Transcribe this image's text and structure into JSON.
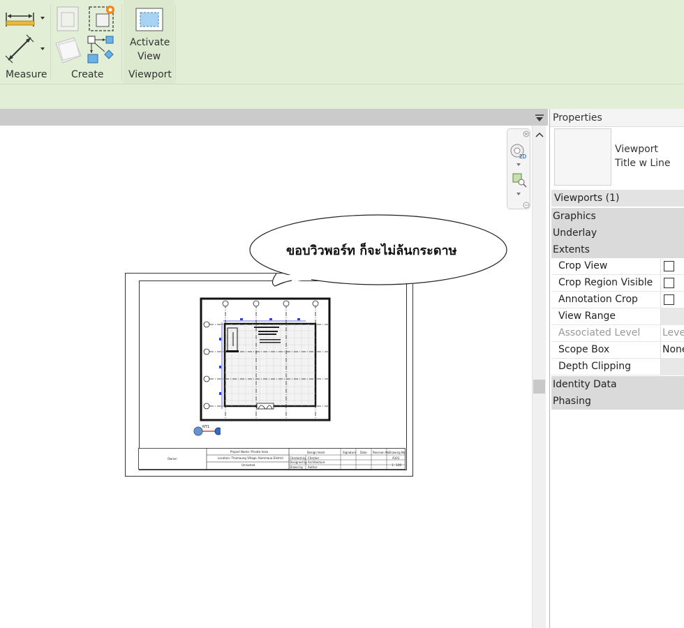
{
  "ribbon": {
    "panels": [
      {
        "label": "Measure"
      },
      {
        "label": "Create"
      },
      {
        "label": "Viewport"
      }
    ],
    "activate_view_label_line1": "Activate",
    "activate_view_label_line2": "View"
  },
  "callout": {
    "text": "ขอบวิวพอร์ท ก็จะไม่ล้นกระดาษ"
  },
  "title_block": {
    "owner": "Owner:",
    "project_name": "Project Name: Private hose",
    "location": "Location: Thamaung Village, Kommaua District",
    "unnamed": "Unnamed",
    "design_team": "Design team",
    "signature": "Signature",
    "date": "Date",
    "revision": "Revision No.",
    "drawing_no": "Drawing No.",
    "checked_by": "Checked by",
    "designed_by": "Designed by",
    "drawn_by": "Drawn by",
    "checker": "Checker",
    "designer": "Architecture",
    "author": "Author",
    "sheet_no": "A101",
    "scale": "1 : 100"
  },
  "viewport_tag": "NT1",
  "properties": {
    "title": "Properties",
    "type_line1": "Viewport",
    "type_line2": "Title w Line",
    "selection": "Viewports (1)",
    "sections": {
      "graphics": "Graphics",
      "underlay": "Underlay",
      "extents": "Extents",
      "identity": "Identity Data",
      "phasing": "Phasing"
    },
    "rows": {
      "crop_view": {
        "label": "Crop View",
        "checked": false
      },
      "crop_region_visible": {
        "label": "Crop Region Visible",
        "checked": false
      },
      "annotation_crop": {
        "label": "Annotation Crop",
        "checked": false
      },
      "view_range": {
        "label": "View Range"
      },
      "associated_level": {
        "label": "Associated Level",
        "value": "Level"
      },
      "scope_box": {
        "label": "Scope Box",
        "value": "None"
      },
      "depth_clipping": {
        "label": "Depth Clipping"
      }
    }
  }
}
